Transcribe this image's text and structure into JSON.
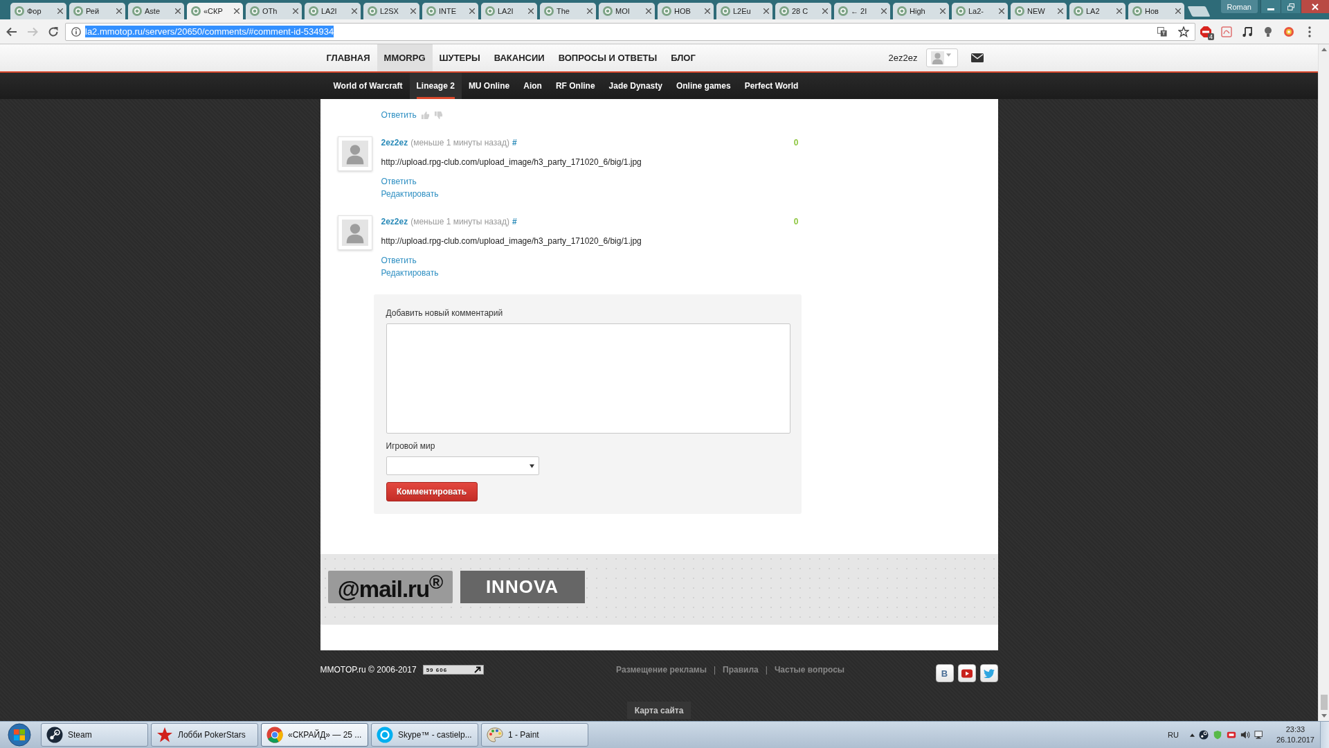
{
  "browser": {
    "tabs": [
      {
        "label": "Фор",
        "selected": false
      },
      {
        "label": "Рей",
        "selected": false
      },
      {
        "label": "Aste",
        "selected": false
      },
      {
        "label": "«СКР",
        "selected": true
      },
      {
        "label": "ОТh",
        "selected": false
      },
      {
        "label": "LA2I",
        "selected": false
      },
      {
        "label": "L2SX",
        "selected": false
      },
      {
        "label": "INTE",
        "selected": false
      },
      {
        "label": "LA2I",
        "selected": false
      },
      {
        "label": "The",
        "selected": false
      },
      {
        "label": "MOI",
        "selected": false
      },
      {
        "label": "НОВ",
        "selected": false
      },
      {
        "label": "L2Eu",
        "selected": false
      },
      {
        "label": "28 C",
        "selected": false
      },
      {
        "label": "← 2I",
        "selected": false
      },
      {
        "label": "High",
        "selected": false
      },
      {
        "label": "La2-",
        "selected": false
      },
      {
        "label": "NEW",
        "selected": false
      },
      {
        "label": "LA2",
        "selected": false
      },
      {
        "label": "Нов",
        "selected": false
      }
    ],
    "profile": "Roman",
    "nav_buttons": [
      {
        "kind": "back",
        "disabled": false
      },
      {
        "kind": "forward",
        "disabled": true
      },
      {
        "kind": "reload",
        "disabled": false
      }
    ],
    "address": {
      "text": "la2.mmotop.ru/servers/20650/comments/#comment-id-534934",
      "selected": true
    },
    "extensions": [
      {
        "kind": "adblock",
        "badge": "4"
      },
      {
        "kind": "pdf"
      },
      {
        "kind": "music"
      },
      {
        "kind": "bulb"
      },
      {
        "kind": "colorwheel"
      }
    ]
  },
  "site_nav": {
    "items": [
      {
        "label": "ГЛАВНАЯ",
        "selected": false
      },
      {
        "label": "MMORPG",
        "selected": true
      },
      {
        "label": "ШУТЕРЫ",
        "selected": false
      },
      {
        "label": "ВАКАНСИИ",
        "selected": false
      },
      {
        "label": "ВОПРОСЫ И ОТВЕТЫ",
        "selected": false
      },
      {
        "label": "БЛОГ",
        "selected": false
      }
    ],
    "username": "2ez2ez"
  },
  "game_nav": {
    "items": [
      {
        "label": "World of Warcraft",
        "selected": false
      },
      {
        "label": "Lineage 2",
        "selected": true
      },
      {
        "label": "MU Online",
        "selected": false
      },
      {
        "label": "Aion",
        "selected": false
      },
      {
        "label": "RF Online",
        "selected": false
      },
      {
        "label": "Jade Dynasty",
        "selected": false
      },
      {
        "label": "Online games",
        "selected": false
      },
      {
        "label": "Perfect World",
        "selected": false
      }
    ]
  },
  "comments": {
    "previous_reply": "Ответить",
    "items": [
      {
        "author": "2ez2ez",
        "time": "(меньше 1 минуты назад)",
        "anchor": "#",
        "score": "0",
        "text": "http://upload.rpg-club.com/upload_image/h3_party_171020_6/big/1.jpg",
        "reply": "Ответить",
        "edit": "Редактировать"
      },
      {
        "author": "2ez2ez",
        "time": "(меньше 1 минуты назад)",
        "anchor": "#",
        "score": "0",
        "text": "http://upload.rpg-club.com/upload_image/h3_party_171020_6/big/1.jpg",
        "reply": "Ответить",
        "edit": "Редактировать"
      }
    ]
  },
  "comment_form": {
    "label": "Добавить новый комментарий",
    "world_label": "Игровой мир",
    "submit": "Комментировать"
  },
  "partners": [
    {
      "kind": "mail",
      "label": "@mail.ru$^{®}$"
    },
    {
      "kind": "innova",
      "label": "INNOVA"
    }
  ],
  "footer": {
    "copyright": "MMOTOP.ru © 2006-2017",
    "counter": "59 606",
    "links": [
      "Размещение рекламы",
      "Правила",
      "Частые вопросы"
    ],
    "separators": [
      "|",
      "|"
    ],
    "social": [
      {
        "kind": "vk",
        "label": "В"
      },
      {
        "kind": "youtube"
      },
      {
        "kind": "twitter"
      }
    ],
    "sitemap": "Карта сайта"
  },
  "taskbar": {
    "items": [
      {
        "kind": "steam",
        "label": "Steam",
        "selected": false
      },
      {
        "kind": "pokerstars",
        "label": "Лобби PokerStars",
        "selected": false
      },
      {
        "kind": "chrome",
        "label": "«СКРАЙД» — 25 ...",
        "selected": true
      },
      {
        "kind": "skype",
        "label": "Skype™ - castielp...",
        "selected": false
      },
      {
        "kind": "paint",
        "label": "1 - Paint",
        "selected": false
      }
    ],
    "language": "RU",
    "time": "23:33",
    "date": "26.10.2017"
  }
}
